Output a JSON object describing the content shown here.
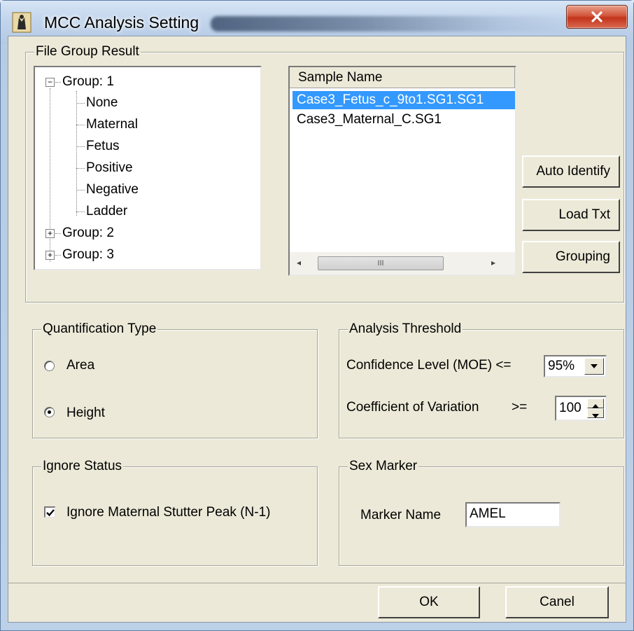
{
  "window": {
    "title": "MCC Analysis Setting",
    "close_label": "X"
  },
  "file_group": {
    "label": "File Group Result",
    "tree": [
      {
        "label": "Group: 1",
        "expanded": true,
        "children": [
          "None",
          "Maternal",
          "Fetus",
          "Positive",
          "Negative",
          "Ladder"
        ]
      },
      {
        "label": "Group: 2",
        "expanded": false,
        "children": []
      },
      {
        "label": "Group: 3",
        "expanded": false,
        "children": []
      }
    ],
    "sample_list": {
      "header": "Sample Name",
      "rows": [
        "Case3_Fetus_c_9to1.SG1.SG1",
        "Case3_Maternal_C.SG1"
      ],
      "selected_index": 0,
      "scroll_thumb_glyph": "III"
    },
    "buttons": {
      "auto_identify": "Auto Identify",
      "load_txt": "Load Txt",
      "grouping": "Grouping"
    }
  },
  "quantification": {
    "label": "Quantification Type",
    "options": [
      "Area",
      "Height"
    ],
    "selected": "Height"
  },
  "threshold": {
    "label": "Analysis Threshold",
    "confidence_label": "Confidence Level (MOE) <=",
    "confidence_value": "95%",
    "cv_label": "Coefficient of Variation",
    "cv_operator": ">=",
    "cv_value": "100"
  },
  "ignore_status": {
    "label": "Ignore Status",
    "checkbox_label": "Ignore Maternal Stutter Peak (N-1)",
    "checked": true
  },
  "sex_marker": {
    "label": "Sex Marker",
    "marker_name_label": "Marker Name",
    "marker_name_value": "AMEL"
  },
  "footer": {
    "ok_label": "OK",
    "cancel_label": "Canel"
  }
}
